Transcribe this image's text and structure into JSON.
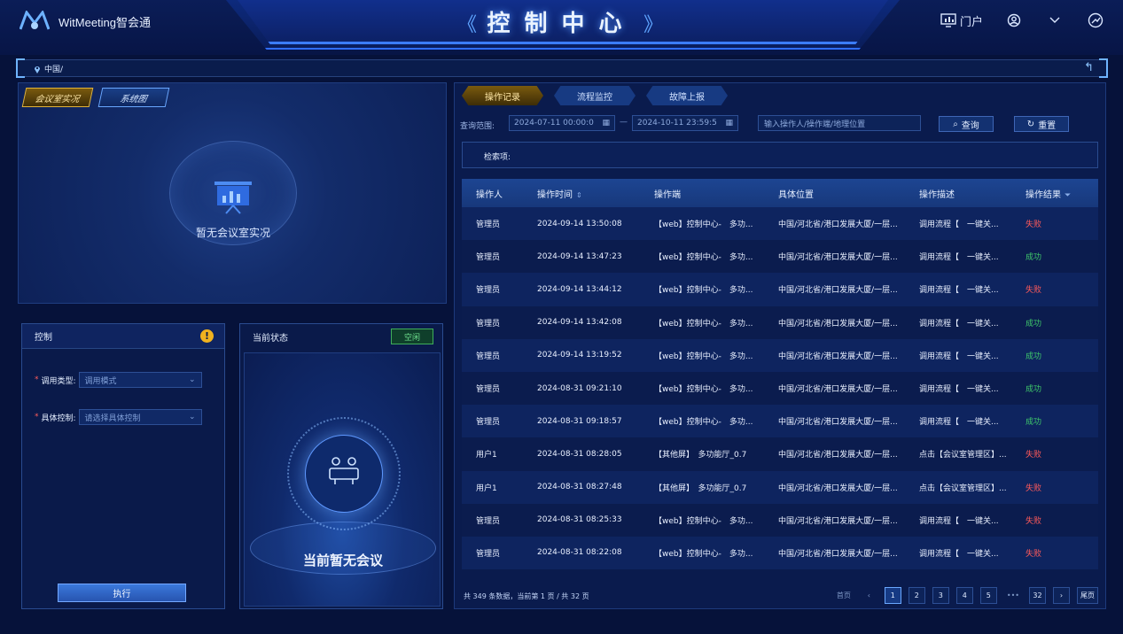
{
  "header": {
    "brand": "WitMeeting智会通",
    "title": "控制中心",
    "left_chevron": "《",
    "right_chevron": "》",
    "portal_label": "门户"
  },
  "breadcrumb": {
    "path": "中国/"
  },
  "preview": {
    "tabs": [
      "会议室实况",
      "系统图"
    ],
    "empty_text": "暂无会议室实况"
  },
  "control": {
    "title": "控制",
    "warn_symbol": "!",
    "fields": [
      {
        "label": "调用类型:",
        "placeholder": "调用模式"
      },
      {
        "label": "具体控制:",
        "placeholder": "请选择具体控制"
      }
    ],
    "required_mark": "*",
    "exec_label": "执行"
  },
  "status": {
    "title": "当前状态",
    "badge": "空闲",
    "empty_text": "当前暂无会议"
  },
  "records": {
    "tabs": [
      "操作记录",
      "流程监控",
      "故障上报"
    ],
    "query_label": "查询范围:",
    "date_from": "2024-07-11 00:00:0",
    "date_sep": "—",
    "date_to": "2024-10-11 23:59:5",
    "search_placeholder": "输入操作人/操作端/地理位置",
    "query_btn": "查询",
    "reset_btn": "重置",
    "filter_label": "检索项:",
    "columns": [
      "操作人",
      "操作时间",
      "操作端",
      "具体位置",
      "操作描述",
      "操作结果"
    ],
    "rows": [
      [
        "管理员",
        "2024-09-14 13:50:08",
        "【web】控制中心-　多功...",
        "中国/河北省/港口发展大厦/一层...",
        "调用流程【　一键关...",
        "失败"
      ],
      [
        "管理员",
        "2024-09-14 13:47:23",
        "【web】控制中心-　多功...",
        "中国/河北省/港口发展大厦/一层...",
        "调用流程【　一键关...",
        "成功"
      ],
      [
        "管理员",
        "2024-09-14 13:44:12",
        "【web】控制中心-　多功...",
        "中国/河北省/港口发展大厦/一层...",
        "调用流程【　一键关...",
        "失败"
      ],
      [
        "管理员",
        "2024-09-14 13:42:08",
        "【web】控制中心-　多功...",
        "中国/河北省/港口发展大厦/一层...",
        "调用流程【　一键关...",
        "成功"
      ],
      [
        "管理员",
        "2024-09-14 13:19:52",
        "【web】控制中心-　多功...",
        "中国/河北省/港口发展大厦/一层...",
        "调用流程【　一键关...",
        "成功"
      ],
      [
        "管理员",
        "2024-08-31 09:21:10",
        "【web】控制中心-　多功...",
        "中国/河北省/港口发展大厦/一层...",
        "调用流程【　一键关...",
        "成功"
      ],
      [
        "管理员",
        "2024-08-31 09:18:57",
        "【web】控制中心-　多功...",
        "中国/河北省/港口发展大厦/一层...",
        "调用流程【　一键关...",
        "成功"
      ],
      [
        "用户1",
        "2024-08-31 08:28:05",
        "【其他屏】　多功能厅_0.7",
        "中国/河北省/港口发展大厦/一层...",
        "点击【会议室管理区】...",
        "失败"
      ],
      [
        "用户1",
        "2024-08-31 08:27:48",
        "【其他屏】　多功能厅_0.7",
        "中国/河北省/港口发展大厦/一层...",
        "点击【会议室管理区】...",
        "失败"
      ],
      [
        "管理员",
        "2024-08-31 08:25:33",
        "【web】控制中心-　多功...",
        "中国/河北省/港口发展大厦/一层...",
        "调用流程【　一键关...",
        "失败"
      ],
      [
        "管理员",
        "2024-08-31 08:22:08",
        "【web】控制中心-　多功...",
        "中国/河北省/港口发展大厦/一层...",
        "调用流程【　一键关...",
        "失败"
      ]
    ],
    "total_text": "共 349 条数据，当前第 1 页 / 共 32 页",
    "pager": {
      "first": "首页",
      "prev": "‹",
      "pages": [
        "1",
        "2",
        "3",
        "4",
        "5"
      ],
      "ellipsis": "•••",
      "last_page": "32",
      "next": "›",
      "last": "尾页"
    }
  },
  "colors": {
    "fail": "#ff5a5a",
    "ok": "#3fca6b",
    "accent": "#3b7cff"
  }
}
